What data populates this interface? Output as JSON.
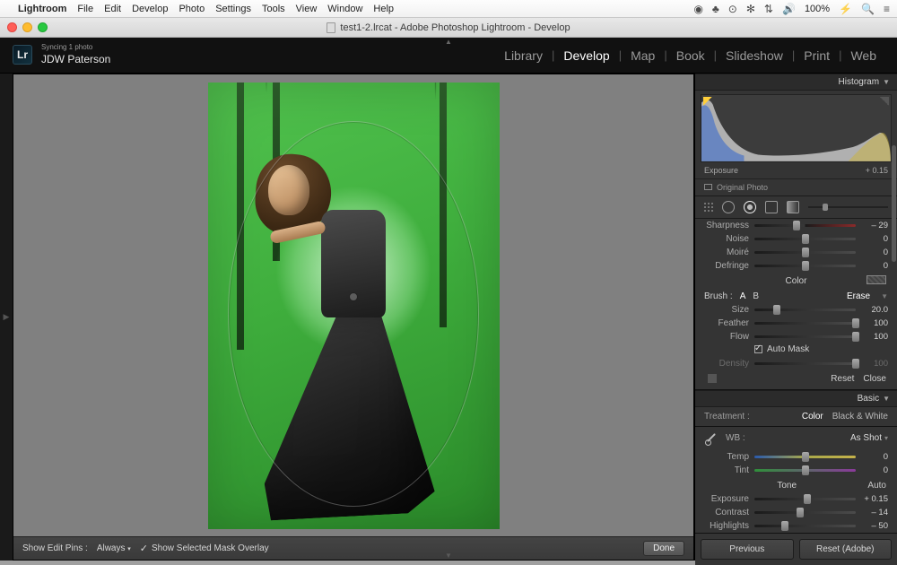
{
  "mac_menu": {
    "app": "Lightroom",
    "items": [
      "File",
      "Edit",
      "Develop",
      "Photo",
      "Settings",
      "Tools",
      "View",
      "Window",
      "Help"
    ],
    "status": {
      "battery": "100%",
      "battery_icon": "⚡",
      "icons": [
        "◉",
        "♣",
        "⊙",
        "✻",
        "⇅",
        "🔊"
      ],
      "search": "🔍",
      "menu": "≡"
    }
  },
  "window_title": "test1-2.lrcat - Adobe Photoshop Lightroom - Develop",
  "identity": {
    "sync": "Syncing 1 photo",
    "name": "JDW Paterson",
    "logo": "Lr"
  },
  "modules": {
    "items": [
      "Library",
      "Develop",
      "Map",
      "Book",
      "Slideshow",
      "Print",
      "Web"
    ],
    "active": "Develop"
  },
  "toolbar": {
    "show_pins_label": "Show Edit Pins :",
    "show_pins_value": "Always",
    "mask_overlay_label": "Show Selected Mask Overlay",
    "mask_overlay_checked": true,
    "done": "Done"
  },
  "panels": {
    "histogram": {
      "title": "Histogram",
      "readout_label": "Exposure",
      "readout_value": "+ 0.15",
      "original": "Original Photo"
    },
    "detail_sliders": [
      {
        "label": "Sharpness",
        "value": "– 29",
        "pos": 42
      },
      {
        "label": "Noise",
        "value": "0",
        "pos": 50
      },
      {
        "label": "Moiré",
        "value": "0",
        "pos": 50
      },
      {
        "label": "Defringe",
        "value": "0",
        "pos": 50
      }
    ],
    "color_label": "Color",
    "brush": {
      "header": "Brush :",
      "a": "A",
      "b": "B",
      "erase": "Erase",
      "sliders": [
        {
          "label": "Size",
          "value": "20.0",
          "pos": 22
        },
        {
          "label": "Feather",
          "value": "100",
          "pos": 100
        },
        {
          "label": "Flow",
          "value": "100",
          "pos": 100
        }
      ],
      "automask": "Auto Mask",
      "density": {
        "label": "Density",
        "value": "100",
        "pos": 100
      },
      "reset": "Reset",
      "close": "Close"
    },
    "basic": {
      "title": "Basic",
      "treatment_label": "Treatment :",
      "treatment_opts": [
        "Color",
        "Black & White"
      ],
      "treatment_active": "Color",
      "wb_label": "WB :",
      "wb_value": "As Shot",
      "temp": {
        "label": "Temp",
        "value": "0",
        "pos": 50
      },
      "tint": {
        "label": "Tint",
        "value": "0",
        "pos": 50
      },
      "tone_label": "Tone",
      "auto": "Auto",
      "tone_sliders": [
        {
          "label": "Exposure",
          "value": "+ 0.15",
          "pos": 52
        },
        {
          "label": "Contrast",
          "value": "– 14",
          "pos": 45
        },
        {
          "label": "Highlights",
          "value": "– 50",
          "pos": 30
        }
      ]
    },
    "buttons": {
      "previous": "Previous",
      "reset": "Reset (Adobe)"
    }
  }
}
